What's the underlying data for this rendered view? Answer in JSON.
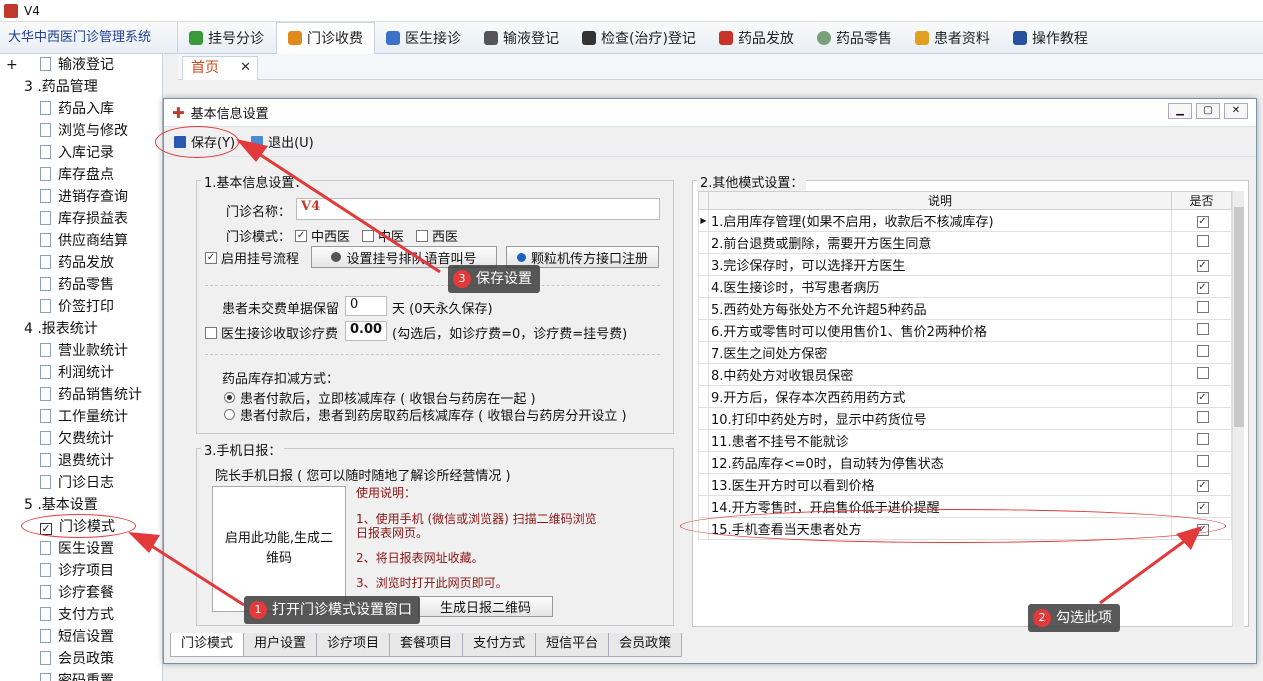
{
  "window": {
    "title": "V4"
  },
  "menubar": {
    "brand": "大华中西医门诊管理系统",
    "items": [
      "挂号分诊",
      "门诊收费",
      "医生接诊",
      "输液登记",
      "检查(治疗)登记",
      "药品发放",
      "药品零售",
      "患者资料",
      "操作教程"
    ]
  },
  "sidebar": {
    "rows": [
      {
        "type": "leaf",
        "label": "输液登记",
        "plus": "+"
      },
      {
        "type": "group",
        "label": "3 .药品管理"
      },
      {
        "type": "leaf",
        "label": "药品入库"
      },
      {
        "type": "leaf",
        "label": "浏览与修改"
      },
      {
        "type": "leaf",
        "label": "入库记录"
      },
      {
        "type": "leaf",
        "label": "库存盘点"
      },
      {
        "type": "leaf",
        "label": "进销存查询"
      },
      {
        "type": "leaf",
        "label": "库存损益表"
      },
      {
        "type": "leaf",
        "label": "供应商结算"
      },
      {
        "type": "leaf",
        "label": "药品发放"
      },
      {
        "type": "leaf",
        "label": "药品零售"
      },
      {
        "type": "leaf",
        "label": "价签打印"
      },
      {
        "type": "group",
        "label": "4 .报表统计"
      },
      {
        "type": "leaf",
        "label": "营业款统计"
      },
      {
        "type": "leaf",
        "label": "利润统计"
      },
      {
        "type": "leaf",
        "label": "药品销售统计"
      },
      {
        "type": "leaf",
        "label": "工作量统计"
      },
      {
        "type": "leaf",
        "label": "欠费统计"
      },
      {
        "type": "leaf",
        "label": "退费统计"
      },
      {
        "type": "leaf",
        "label": "门诊日志"
      },
      {
        "type": "group",
        "label": "5 .基本设置"
      },
      {
        "type": "selected",
        "label": "门诊模式"
      },
      {
        "type": "leaf",
        "label": "医生设置"
      },
      {
        "type": "leaf",
        "label": "诊疗项目"
      },
      {
        "type": "leaf",
        "label": "诊疗套餐"
      },
      {
        "type": "leaf",
        "label": "支付方式"
      },
      {
        "type": "leaf",
        "label": "短信设置"
      },
      {
        "type": "leaf",
        "label": "会员政策"
      },
      {
        "type": "leaf",
        "label": "密码重置"
      }
    ]
  },
  "tabs": {
    "home": "首页",
    "close": "✕"
  },
  "dialog": {
    "title": "基本信息设置",
    "save": "保存(Y)",
    "exit": "退出(U)",
    "group1": {
      "title": "1.基本信息设置：",
      "clinic_name_label": "门诊名称：",
      "clinic_name_value": "V4",
      "mode_label": "门诊模式：",
      "mode_options": [
        {
          "label": "中西医",
          "checked": true
        },
        {
          "label": "中医",
          "checked": false
        },
        {
          "label": "西医",
          "checked": false
        }
      ],
      "enable_register_label": "启用挂号流程",
      "enable_register_checked": true,
      "voice_button": "设置挂号排队语音叫号",
      "granule_button": "颗粒机传方接口注册",
      "keep_label": "患者未交费单据保留",
      "keep_value": "0",
      "keep_suffix": "天 (0天永久保存)",
      "doctor_fee_label": "医生接诊收取诊疗费",
      "doctor_fee_checked": false,
      "doctor_fee_value": "0.00",
      "doctor_fee_hint": "(勾选后，如诊疗费=0，诊疗费=挂号费)",
      "deduct_title": "药品库存扣减方式：",
      "deduct_options": [
        {
          "label": "患者付款后，立即核减库存 ( 收银台与药房在一起 )",
          "checked": true
        },
        {
          "label": "患者付款后，患者到药房取药后核减库存 ( 收银台与药房分开设立 )",
          "checked": false
        }
      ]
    },
    "group3": {
      "title": "3.手机日报：",
      "subtitle": "院长手机日报 ( 您可以随时随地了解诊所经营情况 )",
      "qr_placeholder": "启用此功能,生成二维码",
      "help_title": "使用说明：",
      "help_1a": "1、使用手机 (微信或浏览器) 扫描二维码浏览",
      "help_1b": "日报表网页。",
      "help_2": "2、将日报表网址收藏。",
      "help_3": "3、浏览时打开此网页即可。",
      "gen_button": "生成日报二维码"
    },
    "group2": {
      "title": "2.其他模式设置：",
      "col_desc": "说明",
      "col_yes": "是否",
      "rows": [
        {
          "label": "1.启用库存管理(如果不启用，收款后不核减库存)",
          "checked": true
        },
        {
          "label": "2.前台退费或删除，需要开方医生同意",
          "checked": false
        },
        {
          "label": "3.完诊保存时，可以选择开方医生",
          "checked": true
        },
        {
          "label": "4.医生接诊时，书写患者病历",
          "checked": true
        },
        {
          "label": "5.西药处方每张处方不允许超5种药品",
          "checked": false
        },
        {
          "label": "6.开方或零售时可以使用售价1、售价2两种价格",
          "checked": false
        },
        {
          "label": "7.医生之间处方保密",
          "checked": false
        },
        {
          "label": "8.中药处方对收银员保密",
          "checked": false
        },
        {
          "label": "9.开方后，保存本次西药用药方式",
          "checked": true
        },
        {
          "label": "10.打印中药处方时，显示中药货位号",
          "checked": false
        },
        {
          "label": "11.患者不挂号不能就诊",
          "checked": false
        },
        {
          "label": "12.药品库存<=0时，自动转为停售状态",
          "checked": false
        },
        {
          "label": "13.医生开方时可以看到价格",
          "checked": true
        },
        {
          "label": "14.开方零售时，开启售价低于进价提醒",
          "checked": true
        },
        {
          "label": "15.手机查看当天患者处方",
          "checked": true
        }
      ]
    },
    "bottom_tabs": [
      "门诊模式",
      "用户设置",
      "诊疗项目",
      "套餐项目",
      "支付方式",
      "短信平台",
      "会员政策"
    ]
  },
  "annotations": {
    "c1": {
      "num": "1",
      "text": "打开门诊模式设置窗口"
    },
    "c2": {
      "num": "2",
      "text": "勾选此项"
    },
    "c3": {
      "num": "3",
      "text": "保存设置"
    }
  },
  "colors": {
    "accent_red": "#e23a3a",
    "brand_blue": "#1f3f9a"
  }
}
